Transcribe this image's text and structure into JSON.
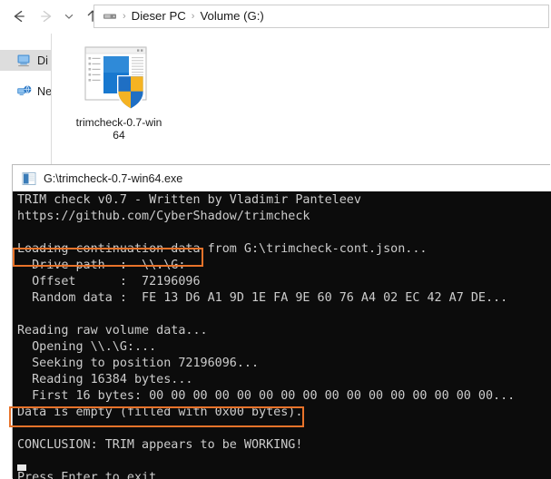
{
  "explorer": {
    "nav": {
      "back_label": "Back",
      "forward_label": "Forward",
      "recent_label": "Recent locations",
      "up_label": "Up one level"
    },
    "addressbar": {
      "drive_icon": "drive-icon",
      "separator": "›",
      "crumbs": [
        {
          "label": "Dieser PC"
        },
        {
          "label": "Volume (G:)"
        }
      ]
    },
    "navpane": {
      "items": [
        {
          "label": "Di",
          "icon": "computer-icon",
          "selected": true
        },
        {
          "label": "Ne",
          "icon": "network-icon",
          "selected": false
        }
      ]
    },
    "content": {
      "files": [
        {
          "name": "trimcheck-0.7-win64",
          "icon": "executable-shield-icon"
        }
      ]
    }
  },
  "console": {
    "title": "G:\\trimcheck-0.7-win64.exe",
    "app_icon": "console-app-icon",
    "background_color": "#0c0c0c",
    "text_color": "#cccccc",
    "annotation_color": "#e8732a",
    "lines": [
      "TRIM check v0.7 - Written by Vladimir Panteleev",
      "https://github.com/CyberShadow/trimcheck",
      "",
      "Loading continuation data from G:\\trimcheck-cont.json...",
      "  Drive path  :  \\\\.\\G:",
      "  Offset      :  72196096",
      "  Random data :  FE 13 D6 A1 9D 1E FA 9E 60 76 A4 02 EC 42 A7 DE...",
      "",
      "Reading raw volume data...",
      "  Opening \\\\.\\G:...",
      "  Seeking to position 72196096...",
      "  Reading 16384 bytes...",
      "  First 16 bytes: 00 00 00 00 00 00 00 00 00 00 00 00 00 00 00 00...",
      "Data is empty (filled with 0x00 bytes).",
      "",
      "CONCLUSION: TRIM appears to be WORKING!",
      "",
      "Press Enter to exit..."
    ],
    "annotations": [
      {
        "name": "drive-path-highlight",
        "target_line": "  Drive path  :  \\\\.\\G:"
      },
      {
        "name": "conclusion-highlight",
        "target_line": "CONCLUSION: TRIM appears to be WORKING!"
      }
    ]
  }
}
